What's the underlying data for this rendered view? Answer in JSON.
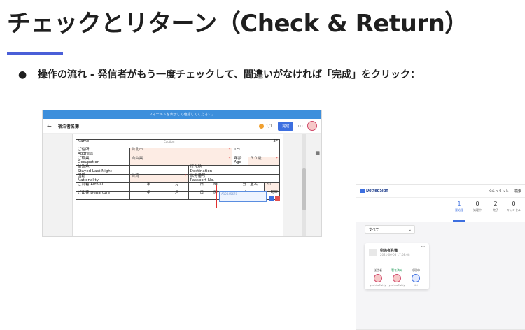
{
  "slide": {
    "title": "チェックとリターン（Check & Return）",
    "bullet": "操作の流れ - 発信者がもう一度チェックして、間違いがなければ「完成」をクリック："
  },
  "left_shot": {
    "notice": "フィールドを表示して確認してください。",
    "doc_name": "宿泊者名簿",
    "page_indicator": "1/1",
    "done_button": "完成",
    "form": {
      "name_label": "Name",
      "caution": "Caution",
      "floor_suffix": "3F",
      "address_label": "ご住所",
      "address_label_en": "Address",
      "address_value": "台北市",
      "tel_label": "TEL",
      "occupation_label": "ご職業",
      "occupation_label_en": "Occupation",
      "occupation_value": "自由業",
      "age_label": "年齢",
      "age_label_en": "Age",
      "age_value": "３０歳",
      "prev_label": "前泊地",
      "prev_label_en": "Stayed Last Night",
      "dest_label": "行先地",
      "dest_label_en": "Destination",
      "nation_label": "国籍",
      "nation_label_en": "Nationality",
      "nation_value": "台湾",
      "passport_label": "旅券番号",
      "passport_label_en": "Passport No.",
      "passport_placeholder": "A12345678",
      "arrival_label": "ご到着 Arrival",
      "departure_label": "ご出発 Departure",
      "year": "年",
      "month": "月",
      "day": "日",
      "hour": "時",
      "minute": "分",
      "room_name": "室名",
      "room_number": "号室",
      "room_value": "201"
    }
  },
  "right_shot": {
    "logo": "DottedSign",
    "nav": [
      "ドキュメント",
      "検索"
    ],
    "stats": [
      {
        "num": "1",
        "label": "要処理",
        "active": true
      },
      {
        "num": "0",
        "label": "処理中",
        "active": false
      },
      {
        "num": "2",
        "label": "完了",
        "active": false
      },
      {
        "num": "0",
        "label": "キャンセル",
        "active": false
      }
    ],
    "filter": "すべて",
    "card": {
      "title": "宿泊者名簿",
      "date": "2021-06-08 17:08:08",
      "steps": [
        {
          "role": "送信者",
          "who": "yoshiro7ishiy"
        },
        {
          "role": "署名済み",
          "who": "yoshiro7ishiy"
        },
        {
          "role": "処理中",
          "who": "Kei"
        }
      ]
    }
  },
  "colors": {
    "accent": "#4a5fd8",
    "highlight": "#e03030",
    "button_blue": "#3d6fe0"
  }
}
